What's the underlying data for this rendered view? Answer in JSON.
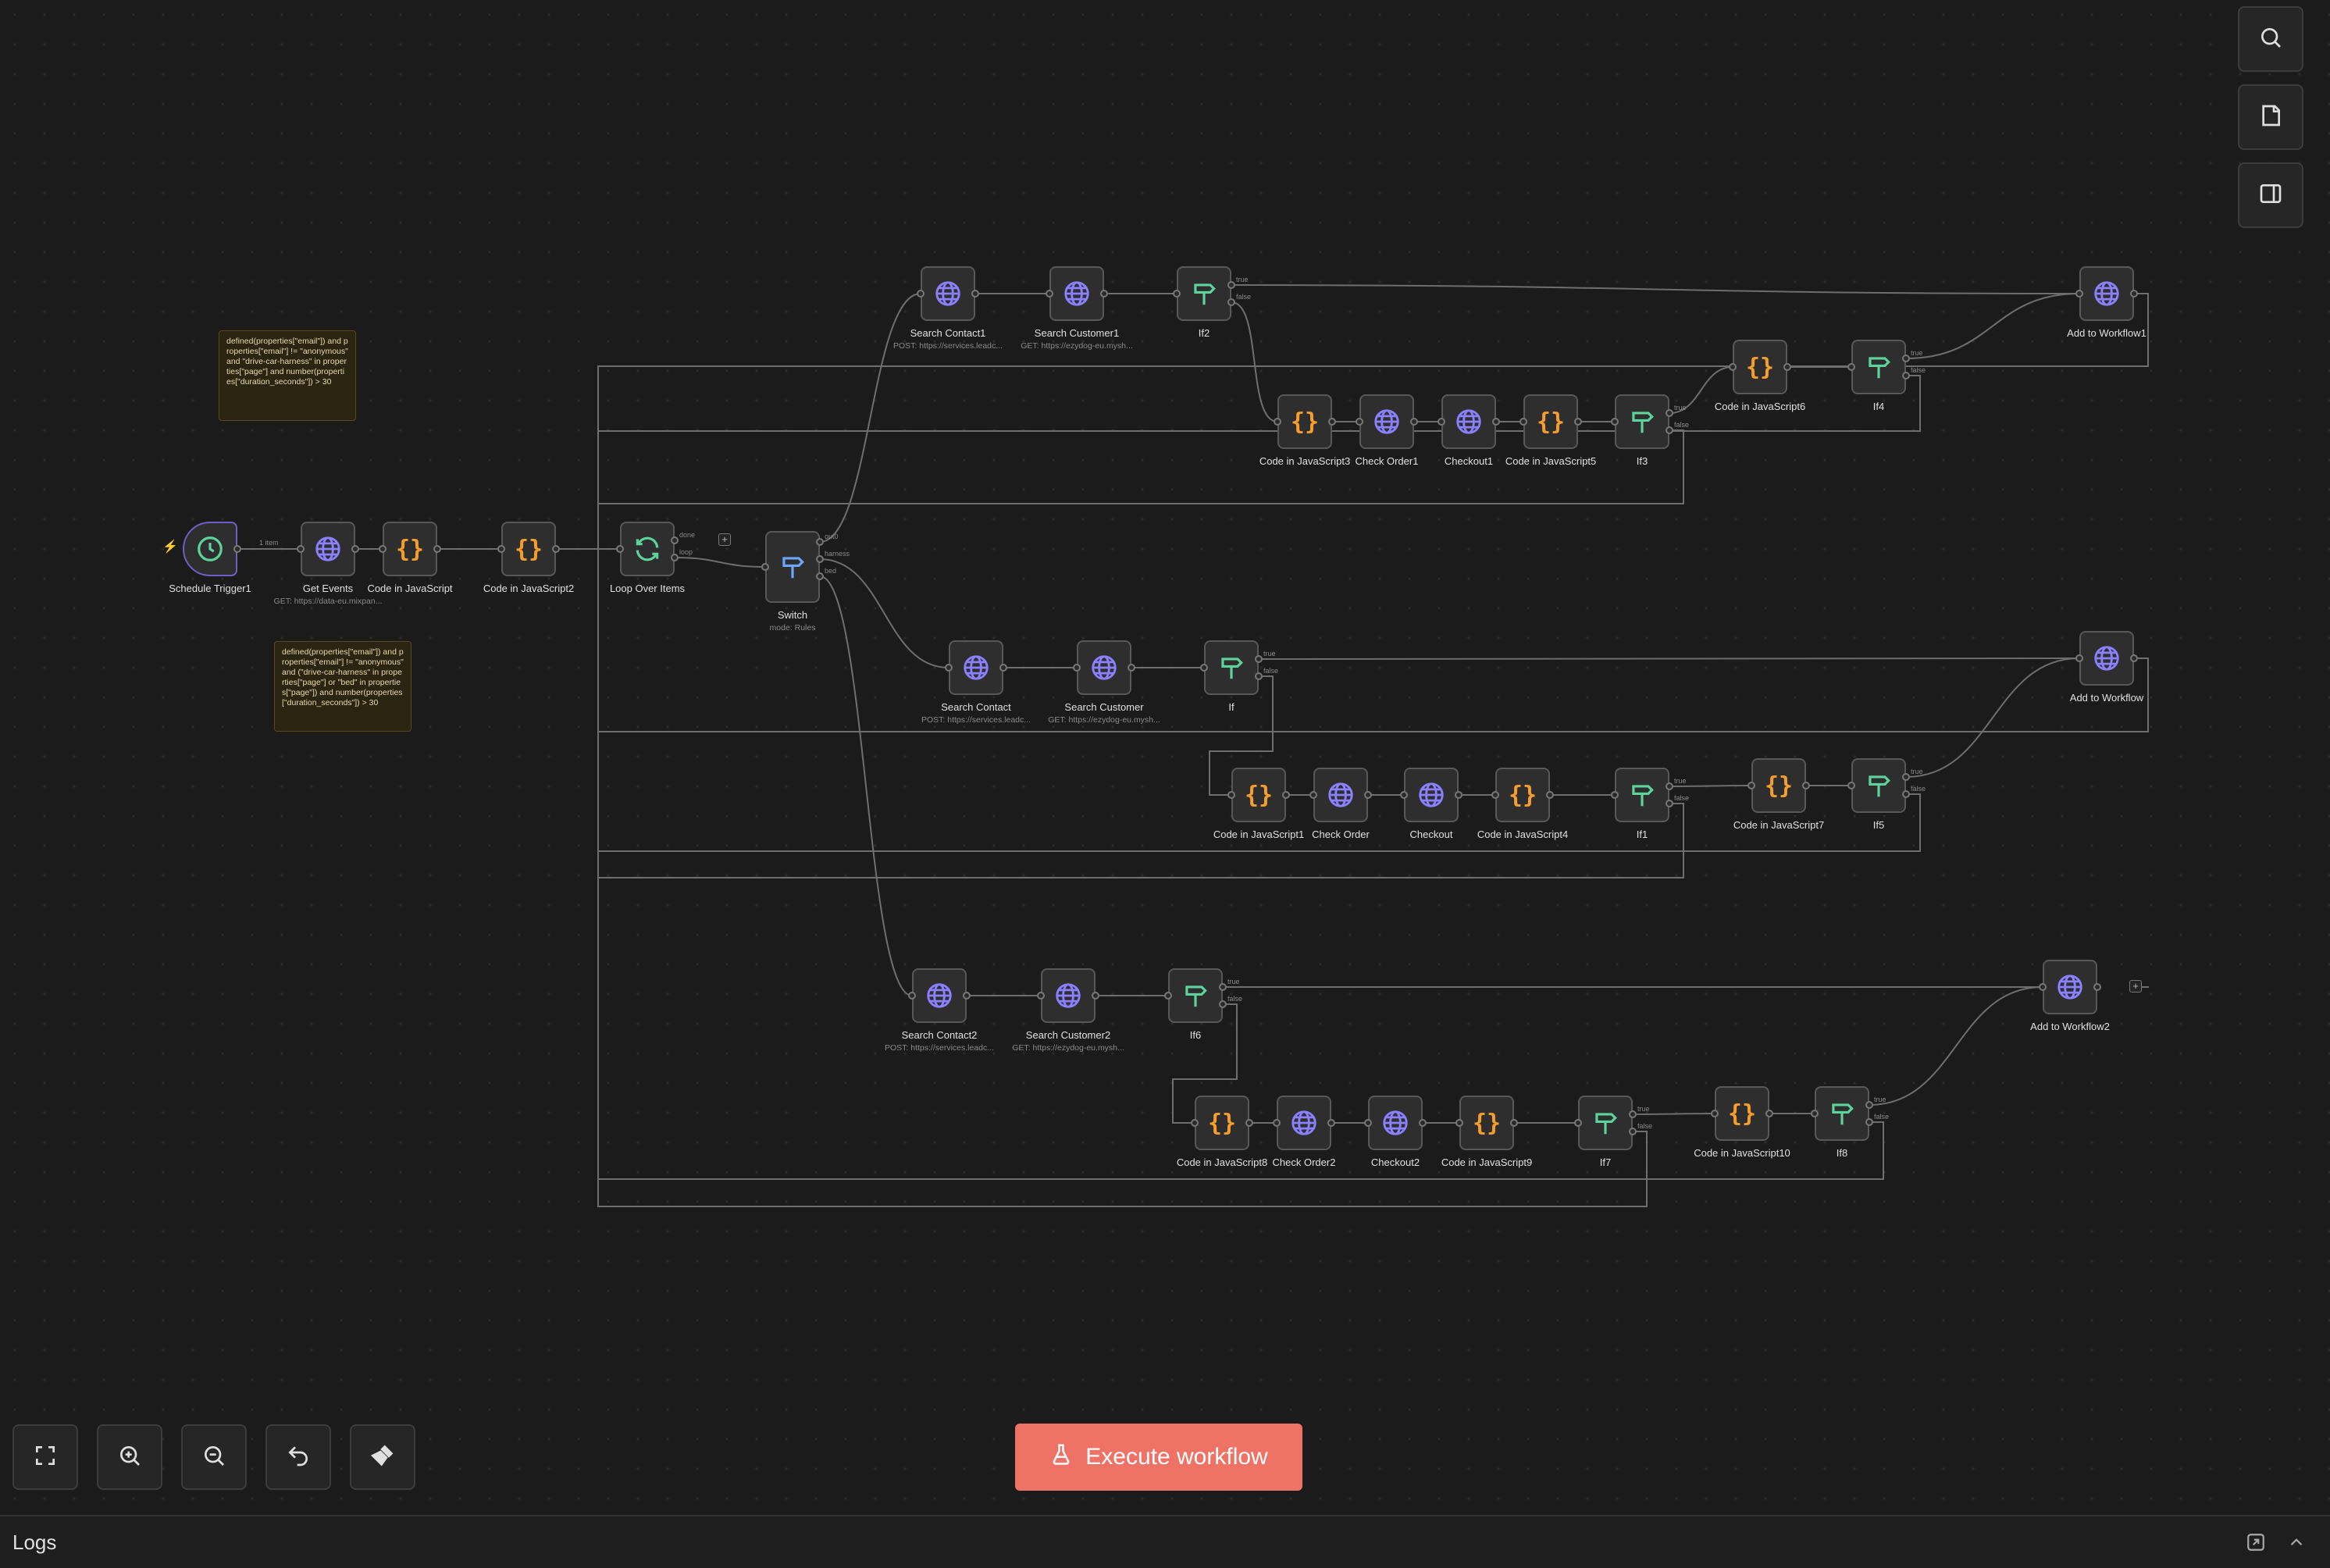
{
  "nodes": [
    {
      "id": "schedule",
      "label": "Schedule Trigger1",
      "sub": "",
      "icon": "clock-icon"
    },
    {
      "id": "get_events",
      "label": "Get Events",
      "sub": "GET: https://data-eu.mixpan...",
      "icon": "globe-icon"
    },
    {
      "id": "code_js",
      "label": "Code in JavaScript",
      "sub": "",
      "icon": "code-icon"
    },
    {
      "id": "code_js2",
      "label": "Code in JavaScript2",
      "sub": "",
      "icon": "code-icon"
    },
    {
      "id": "loop",
      "label": "Loop Over Items",
      "sub": "",
      "icon": "loop-icon"
    },
    {
      "id": "switch",
      "label": "Switch",
      "sub": "mode: Rules",
      "icon": "switch-icon"
    },
    {
      "id": "search_contact1",
      "label": "Search Contact1",
      "sub": "POST: https://services.leadc...",
      "icon": "globe-icon"
    },
    {
      "id": "search_customer1",
      "label": "Search Customer1",
      "sub": "GET: https://ezydog-eu.mysh...",
      "icon": "globe-icon"
    },
    {
      "id": "if2",
      "label": "If2",
      "sub": "",
      "icon": "if-icon"
    },
    {
      "id": "add_wf1",
      "label": "Add to Workflow1",
      "sub": "",
      "icon": "globe-icon"
    },
    {
      "id": "code_js6",
      "label": "Code in JavaScript6",
      "sub": "",
      "icon": "code-icon"
    },
    {
      "id": "if4",
      "label": "If4",
      "sub": "",
      "icon": "if-icon"
    },
    {
      "id": "code_js3",
      "label": "Code in JavaScript3",
      "sub": "",
      "icon": "code-icon"
    },
    {
      "id": "check_order1",
      "label": "Check Order1",
      "sub": "",
      "icon": "globe-icon"
    },
    {
      "id": "checkout1",
      "label": "Checkout1",
      "sub": "",
      "icon": "globe-icon"
    },
    {
      "id": "code_js5",
      "label": "Code in JavaScript5",
      "sub": "",
      "icon": "code-icon"
    },
    {
      "id": "if3",
      "label": "If3",
      "sub": "",
      "icon": "if-icon"
    },
    {
      "id": "search_contact",
      "label": "Search Contact",
      "sub": "POST: https://services.leadc...",
      "icon": "globe-icon"
    },
    {
      "id": "search_customer",
      "label": "Search Customer",
      "sub": "GET: https://ezydog-eu.mysh...",
      "icon": "globe-icon"
    },
    {
      "id": "if",
      "label": "If",
      "sub": "",
      "icon": "if-icon"
    },
    {
      "id": "add_wf",
      "label": "Add to Workflow",
      "sub": "",
      "icon": "globe-icon"
    },
    {
      "id": "code_js1",
      "label": "Code in JavaScript1",
      "sub": "",
      "icon": "code-icon"
    },
    {
      "id": "check_order",
      "label": "Check Order",
      "sub": "",
      "icon": "globe-icon"
    },
    {
      "id": "checkout",
      "label": "Checkout",
      "sub": "",
      "icon": "globe-icon"
    },
    {
      "id": "code_js4",
      "label": "Code in JavaScript4",
      "sub": "",
      "icon": "code-icon"
    },
    {
      "id": "if1",
      "label": "If1",
      "sub": "",
      "icon": "if-icon"
    },
    {
      "id": "code_js7",
      "label": "Code in JavaScript7",
      "sub": "",
      "icon": "code-icon"
    },
    {
      "id": "if5",
      "label": "If5",
      "sub": "",
      "icon": "if-icon"
    },
    {
      "id": "search_contact2",
      "label": "Search Contact2",
      "sub": "POST: https://services.leadc...",
      "icon": "globe-icon"
    },
    {
      "id": "search_customer2",
      "label": "Search Customer2",
      "sub": "GET: https://ezydog-eu.mysh...",
      "icon": "globe-icon"
    },
    {
      "id": "if6",
      "label": "If6",
      "sub": "",
      "icon": "if-icon"
    },
    {
      "id": "add_wf2",
      "label": "Add to Workflow2",
      "sub": "",
      "icon": "globe-icon"
    },
    {
      "id": "code_js8",
      "label": "Code in JavaScript8",
      "sub": "",
      "icon": "code-icon"
    },
    {
      "id": "check_order2",
      "label": "Check Order2",
      "sub": "",
      "icon": "globe-icon"
    },
    {
      "id": "checkout2",
      "label": "Checkout2",
      "sub": "",
      "icon": "globe-icon"
    },
    {
      "id": "code_js9",
      "label": "Code in JavaScript9",
      "sub": "",
      "icon": "code-icon"
    },
    {
      "id": "if7",
      "label": "If7",
      "sub": "",
      "icon": "if-icon"
    },
    {
      "id": "code_js10",
      "label": "Code in JavaScript10",
      "sub": "",
      "icon": "code-icon"
    },
    {
      "id": "if8",
      "label": "If8",
      "sub": "",
      "icon": "if-icon"
    }
  ],
  "edge_labels": {
    "items": "1 item"
  },
  "port_labels": {
    "true": "true",
    "false": "false",
    "done": "done",
    "loop": "loop",
    "switch_out0": "out0",
    "switch_out1": "harness",
    "switch_out2": "bed"
  },
  "notes": [
    "defined(properties[\"email\"]) and properties[\"email\"] != \"anonymous\" and \"drive-car-harness\" in properties[\"page\"] and number(properties[\"duration_seconds\"]) > 30",
    "defined(properties[\"email\"]) and properties[\"email\"] != \"anonymous\" and (\"drive-car-harness\" in properties[\"page\"] or \"bed\" in properties[\"page\"]) and number(properties[\"duration_seconds\"]) > 30"
  ],
  "side_buttons": [
    "search-icon",
    "sticky-note-icon",
    "panel-toggle-icon"
  ],
  "controls": [
    "fit-view-icon",
    "zoom-in-icon",
    "zoom-out-icon",
    "undo-icon",
    "clear-execution-icon"
  ],
  "execute_button": {
    "label": "Execute workflow",
    "icon": "flask-icon",
    "color": "#ee7366"
  },
  "logs": {
    "title": "Logs"
  },
  "colors": {
    "canvas": "#1b1b1b",
    "node_bg": "#2e2e2e",
    "code_icon": "#f59e2c",
    "http_icon": "#8b80ff",
    "if_icon": "#5dd39e",
    "trigger_border": "#6e5fc6",
    "note_bg": "#2a2410"
  }
}
